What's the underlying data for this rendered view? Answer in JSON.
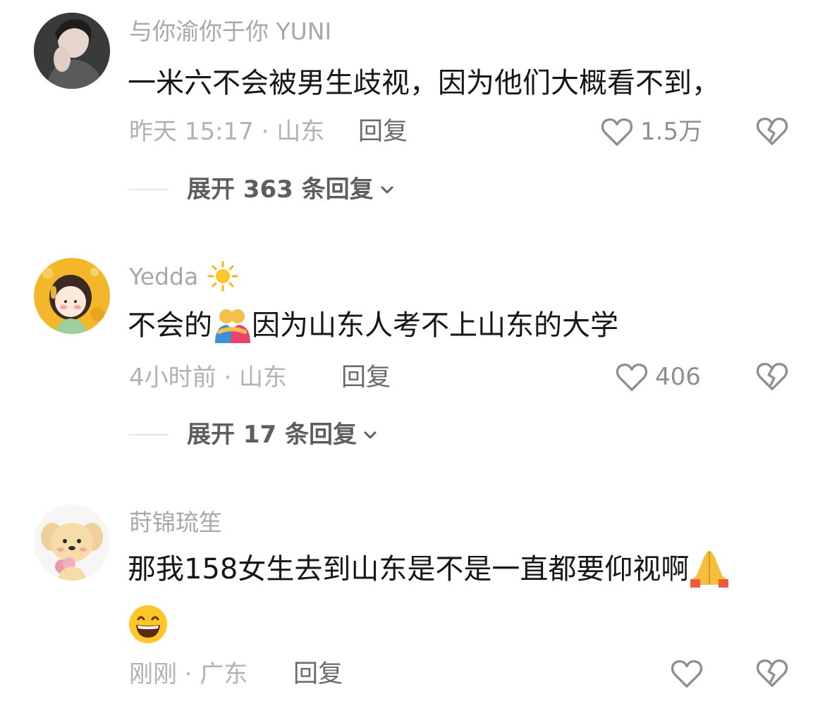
{
  "comments": [
    {
      "username": "与你渝你于你 YUNI",
      "content": "一米六不会被男生歧视，因为他们大概看不到，",
      "time_location": "昨天 15:17 · 山东",
      "reply_label": "回复",
      "like_count": "1.5万",
      "expand_label": "展开 363 条回复",
      "avatar_icon": "portrait-photo-avatar"
    },
    {
      "username": "Yedda",
      "username_icon": "sun-emoji",
      "content_before_emoji": "不会的",
      "content_emoji": "people-hugging-emoji",
      "content_after_emoji": "因为山东人考不上山东的大学",
      "time_location": "4小时前 · 山东",
      "reply_label": "回复",
      "like_count": "406",
      "expand_label": "展开 17 条回复",
      "avatar_icon": "cartoon-girl-avatar"
    },
    {
      "username": "莳锦琉笙",
      "content": "那我158女生去到山东是不是一直都要仰视啊",
      "content_emoji": "folded-hands-emoji",
      "content_line2_emoji": "grinning-face-emoji",
      "time_location": "刚刚 · 广东",
      "reply_label": "回复",
      "like_count": "",
      "avatar_icon": "cartoon-puppy-avatar"
    }
  ],
  "colors": {
    "text_primary": "#161616",
    "text_secondary": "#a8a8a8",
    "icon_gray": "#8f8f8f",
    "background": "#ffffff"
  }
}
